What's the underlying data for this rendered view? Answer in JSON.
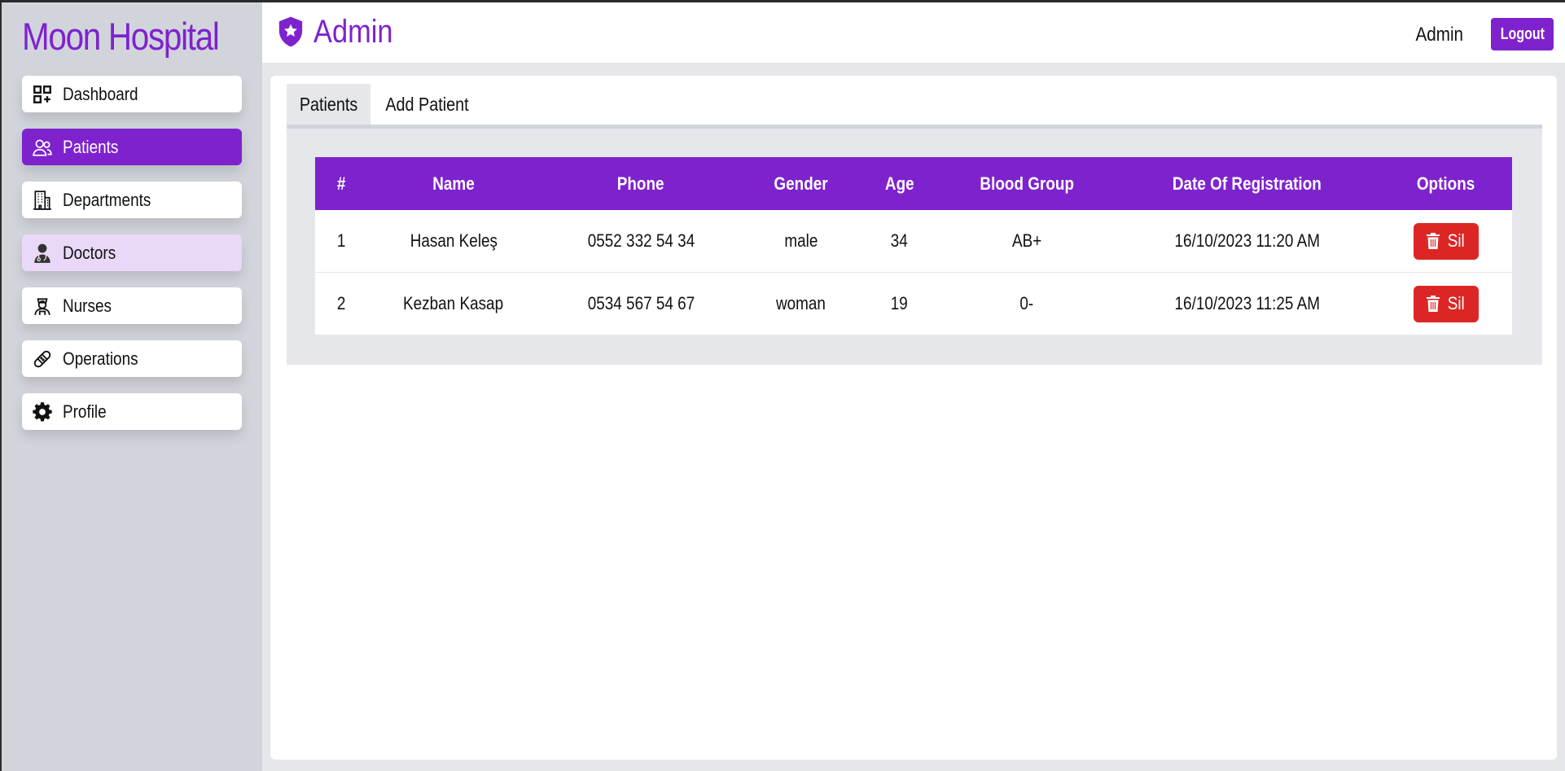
{
  "brand": "Moon Hospital",
  "sidebar": {
    "items": [
      {
        "label": "Dashboard",
        "icon": "dashboard-grid-icon"
      },
      {
        "label": "Patients",
        "icon": "users-icon"
      },
      {
        "label": "Departments",
        "icon": "building-icon"
      },
      {
        "label": "Doctors",
        "icon": "doctor-icon"
      },
      {
        "label": "Nurses",
        "icon": "nurse-icon"
      },
      {
        "label": "Operations",
        "icon": "bandage-icon"
      },
      {
        "label": "Profile",
        "icon": "gear-icon"
      }
    ]
  },
  "header": {
    "title": "Admin",
    "user": "Admin",
    "logout_label": "Logout"
  },
  "tabs": [
    {
      "label": "Patients"
    },
    {
      "label": "Add Patient"
    }
  ],
  "table": {
    "columns": [
      "#",
      "Name",
      "Phone",
      "Gender",
      "Age",
      "Blood Group",
      "Date Of Registration",
      "Options"
    ],
    "rows": [
      {
        "no": "1",
        "name": "Hasan Keleş",
        "phone": "0552 332 54 34",
        "gender": "male",
        "age": "34",
        "blood": "AB+",
        "date": "16/10/2023 11:20 AM",
        "action": "Sil"
      },
      {
        "no": "2",
        "name": "Kezban Kasap",
        "phone": "0534 567 54 67",
        "gender": "woman",
        "age": "19",
        "blood": "0-",
        "date": "16/10/2023 11:25 AM",
        "action": "Sil"
      }
    ]
  },
  "colors": {
    "accent": "#7e22ce",
    "danger": "#dc2626",
    "sidebar_bg": "#d1d5db",
    "hover_bg": "#ead8f8"
  }
}
